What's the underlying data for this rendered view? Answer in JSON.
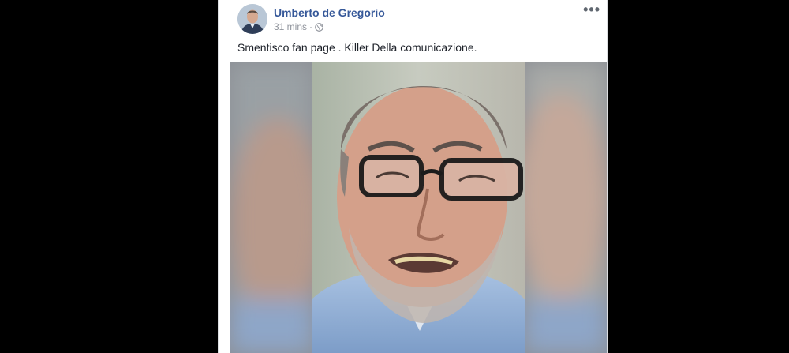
{
  "post": {
    "author": "Umberto de Gregorio",
    "timestamp": "31 mins",
    "separator": "·",
    "privacy_icon": "globe-icon",
    "more_icon": "more-options-icon",
    "more_label": "•••",
    "text": "Smentisco fan page . Killer Della comunicazione."
  },
  "colors": {
    "author_link": "#365899",
    "meta_text": "#90949c",
    "body_text": "#1d2129",
    "page_background": "#000000"
  }
}
